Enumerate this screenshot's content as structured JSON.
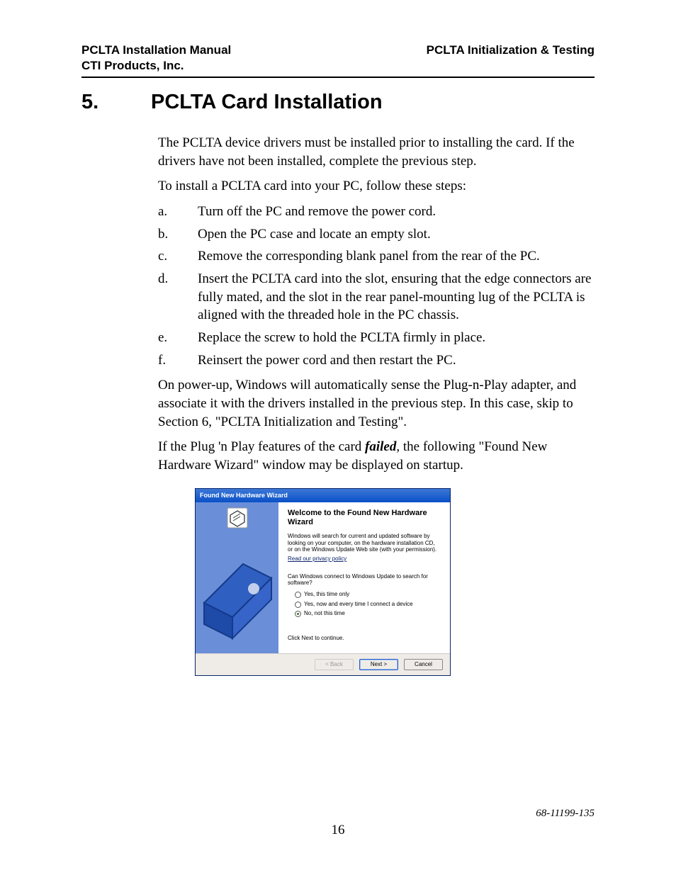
{
  "header": {
    "left_line1": "PCLTA Installation Manual",
    "left_line2": "CTI Products, Inc.",
    "right": "PCLTA Initialization & Testing"
  },
  "section": {
    "number": "5.",
    "title": "PCLTA Card Installation"
  },
  "intro1": "The PCLTA device drivers must be installed prior to installing the card.  If the drivers have not been installed, complete the previous step.",
  "intro2": "To install a PCLTA card into your PC, follow these steps:",
  "steps": [
    {
      "letter": "a.",
      "text": "Turn off the PC and remove the power cord."
    },
    {
      "letter": "b.",
      "text": "Open the PC case and locate an empty slot."
    },
    {
      "letter": "c.",
      "text": "Remove the corresponding blank panel from the rear of the PC."
    },
    {
      "letter": "d.",
      "text": "Insert the PCLTA card into the slot, ensuring that the edge connectors are fully mated, and the slot in the rear panel-mounting lug of the PCLTA is aligned with the threaded hole in the PC chassis."
    },
    {
      "letter": "e.",
      "text": "Replace the screw to hold the PCLTA firmly in place."
    },
    {
      "letter": "f.",
      "text": "Reinsert the power cord and then restart the PC."
    }
  ],
  "post1": "On power-up, Windows will automatically sense the Plug-n-Play adapter, and associate it with the drivers installed in the previous step.  In this case, skip to Section 6, \"PCLTA Initialization and Testing\".",
  "post2a": "If the Plug 'n Play features of the card ",
  "post2_failed": "failed",
  "post2b": ", the following \"Found New Hardware Wizard\" window may be displayed on startup.",
  "wizard": {
    "titlebar": "Found New Hardware Wizard",
    "title": "Welcome to the Found New Hardware Wizard",
    "desc": "Windows will search for current and updated software by looking on your computer, on the hardware installation CD, or on the Windows Update Web site (with your permission).",
    "link": "Read our privacy policy",
    "question": "Can Windows connect to Windows Update to search for software?",
    "opt1": "Yes, this time only",
    "opt2": "Yes, now and every time I connect a device",
    "opt3": "No, not this time",
    "continue": "Click Next to continue.",
    "back": "< Back",
    "next": "Next >",
    "cancel": "Cancel"
  },
  "footer": {
    "page": "16",
    "docid": "68-11199-135"
  }
}
